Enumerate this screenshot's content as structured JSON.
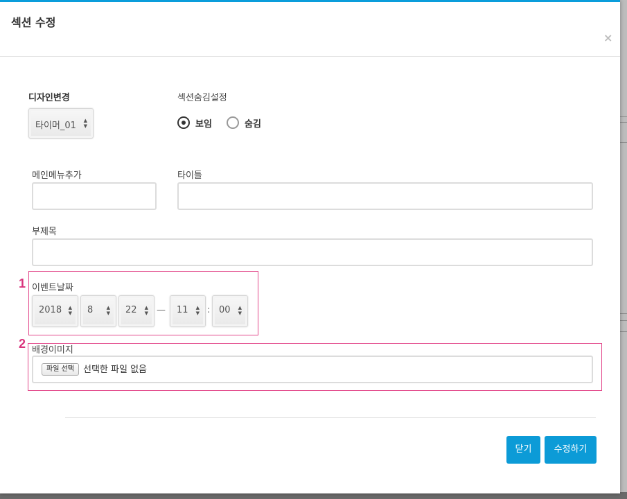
{
  "modal": {
    "title": "섹션 수정",
    "close_symbol": "×",
    "accent_color": "#0a9ddb"
  },
  "design": {
    "label": "디자인변경",
    "selected": "타이머_01"
  },
  "visibility": {
    "label": "섹션숨김설정",
    "options": [
      {
        "label": "보임",
        "checked": true
      },
      {
        "label": "숨김",
        "checked": false
      }
    ]
  },
  "main_menu": {
    "label": "메인메뉴추가",
    "value": ""
  },
  "title_field": {
    "label": "타이틀",
    "value": ""
  },
  "subtitle_field": {
    "label": "부제목",
    "value": ""
  },
  "event_date": {
    "step": "1",
    "label": "이벤트날짜",
    "year": "2018",
    "month": "8",
    "day": "22",
    "dash": "—",
    "hour": "11",
    "colon": ":",
    "minute": "00"
  },
  "background_image": {
    "step": "2",
    "label": "배경이미지",
    "button_label": "파일 선택",
    "status": "선택한 파일 없음"
  },
  "buttons": {
    "close": "닫기",
    "save": "수정하기",
    "color": "#0c9bd7"
  },
  "highlight_color": "#e2478a"
}
